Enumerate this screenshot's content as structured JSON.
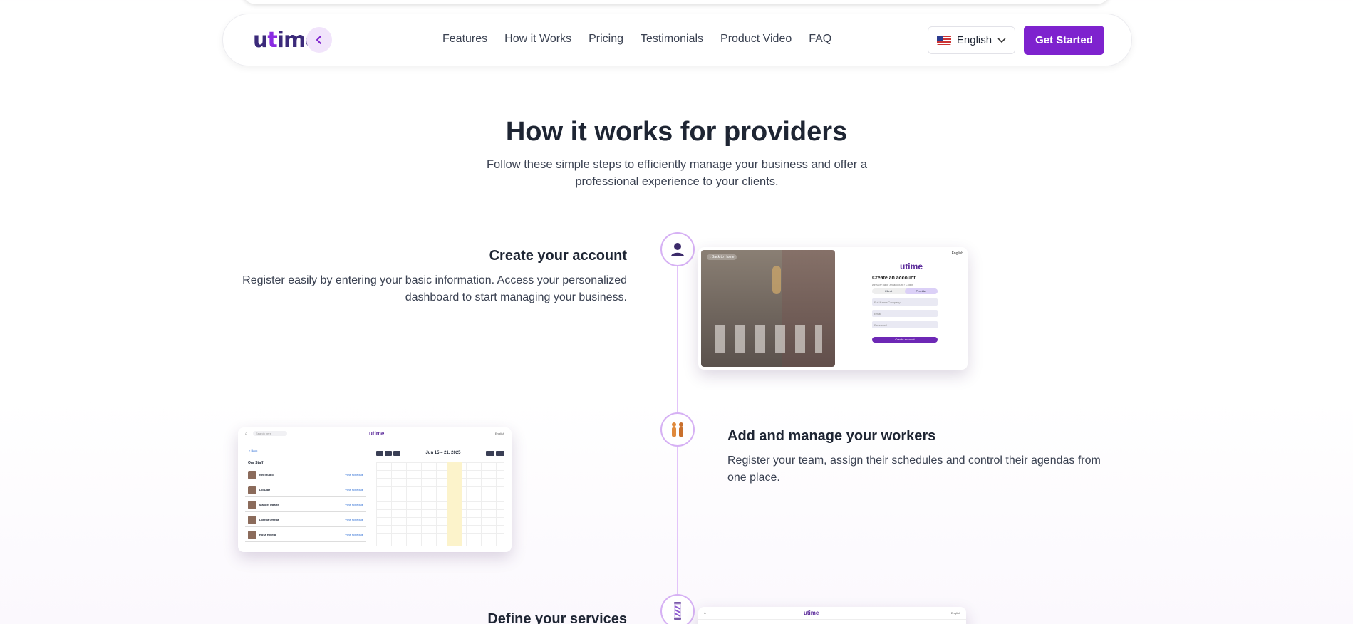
{
  "nav": {
    "logo": "utime",
    "links": [
      "Features",
      "How it Works",
      "Pricing",
      "Testimonials",
      "Product Video",
      "FAQ"
    ],
    "language": "English",
    "cta": "Get Started"
  },
  "section": {
    "title": "How it works for providers",
    "subtitle": "Follow these simple steps to efficiently manage your business and offer a professional experience to your clients."
  },
  "steps": [
    {
      "icon": "person-icon",
      "title": "Create your account",
      "description": "Register easily by entering your basic information. Access your personalized dashboard to start managing your business."
    },
    {
      "icon": "workers-icon",
      "title": "Add and manage your workers",
      "description": "Register your team, assign their schedules and control their agendas from one place."
    },
    {
      "icon": "barber-pole-icon",
      "title": "Define your services",
      "description": ""
    }
  ],
  "preview_signup": {
    "back": "‹ Back to Home",
    "logo": "utime",
    "lang": "English",
    "heading": "Create an account",
    "note": "Already have an account? Log in",
    "toggle": [
      "Client",
      "Provider"
    ],
    "fields": [
      "Full Name/Company",
      "Email",
      "Password"
    ],
    "button": "Create account"
  },
  "preview_staff": {
    "search": "Search here",
    "logo": "utime",
    "lang": "English",
    "back": "‹ Back",
    "heading": "Our Staff",
    "date": "Jun 15 – 21, 2025",
    "workers": [
      "Nel Studio",
      "Lili Diaz",
      "Manuel Ugarte",
      "Lorena Ortega",
      "Rosa Rivera"
    ],
    "link": "View schedule"
  },
  "preview_services": {
    "logo": "utime",
    "lang": "English"
  },
  "colors": {
    "brand": "#7e22ce",
    "timeline": "#e3c4fa",
    "text": "#1e2533"
  }
}
